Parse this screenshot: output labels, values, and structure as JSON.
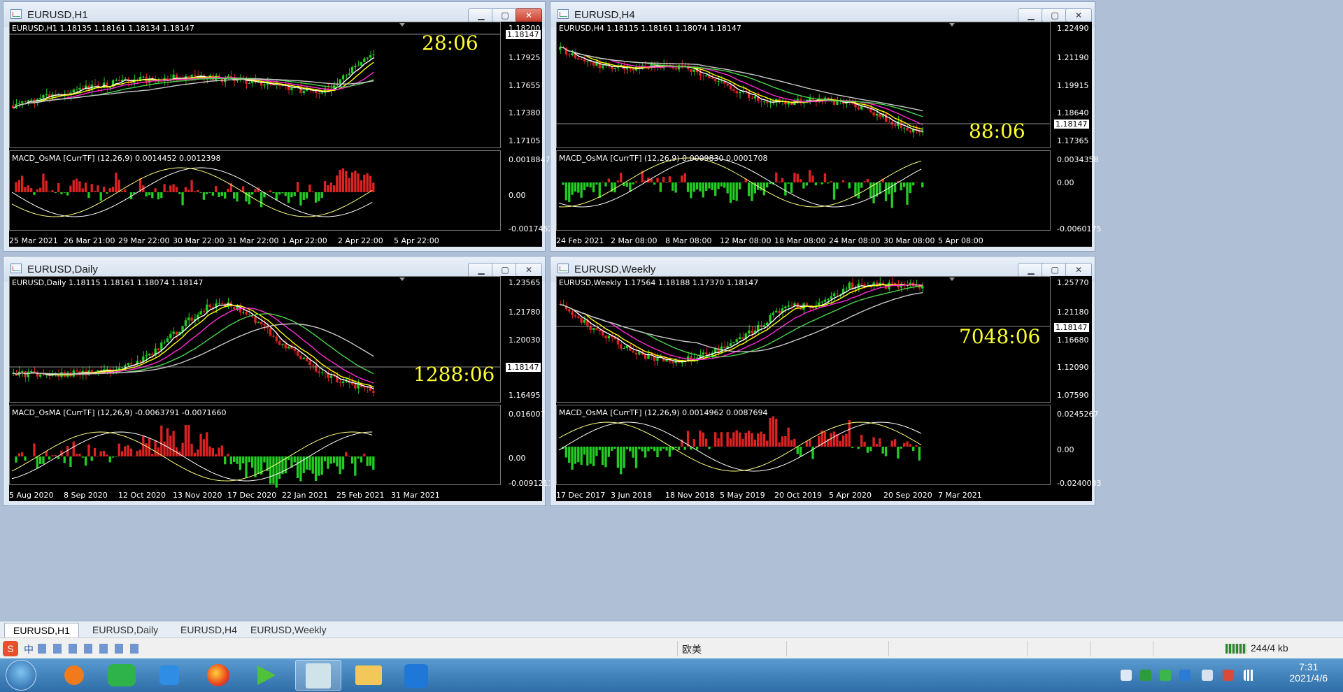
{
  "windows": [
    {
      "id": "h1",
      "title": "EURUSD,H1",
      "info": "EURUSD,H1  1.18135 1.18161 1.18134 1.18147",
      "indicator": "MACD_OsMA [CurrTF] (12,26,9) 0.0014452 0.0012398",
      "price_ticks": [
        "1.18200",
        "1.17925",
        "1.17655",
        "1.17380",
        "1.17105"
      ],
      "current_price": "1.18147",
      "macd_ticks": [
        "0.0018847",
        "0.00",
        "-0.0017452"
      ],
      "countdown": "28:06",
      "dates": [
        "25 Mar 2021",
        "26 Mar 21:00",
        "29 Mar 22:00",
        "30 Mar 22:00",
        "31 Mar 22:00",
        "1 Apr 22:00",
        "2 Apr 22:00",
        "5 Apr 22:00"
      ],
      "close_active": true
    },
    {
      "id": "h4",
      "title": "EURUSD,H4",
      "info": "EURUSD,H4  1.18115 1.18161 1.18074 1.18147",
      "indicator": "MACD_OsMA [CurrTF] (12,26,9) 0.0009830 0.0001708",
      "price_ticks": [
        "1.22490",
        "1.21190",
        "1.19915",
        "1.18640",
        "1.17365"
      ],
      "current_price": "1.18147",
      "macd_ticks": [
        "0.0034358",
        "0.00",
        "-0.0060175"
      ],
      "countdown": "88:06",
      "dates": [
        "24 Feb 2021",
        "2 Mar 08:00",
        "8 Mar 08:00",
        "12 Mar 08:00",
        "18 Mar 08:00",
        "24 Mar 08:00",
        "30 Mar 08:00",
        "5 Apr 08:00"
      ],
      "close_active": false
    },
    {
      "id": "daily",
      "title": "EURUSD,Daily",
      "info": "EURUSD,Daily  1.18115 1.18161 1.18074 1.18147",
      "indicator": "MACD_OsMA [CurrTF] (12,26,9) -0.0063791 -0.0071660",
      "price_ticks": [
        "1.23565",
        "1.21780",
        "1.20030",
        "1.18147",
        "1.16495"
      ],
      "current_price": "1.18147",
      "macd_ticks": [
        "0.016007",
        "0.00",
        "-0.0091211"
      ],
      "countdown": "1288:06",
      "dates": [
        "5 Aug 2020",
        "8 Sep 2020",
        "12 Oct 2020",
        "13 Nov 2020",
        "17 Dec 2020",
        "22 Jan 2021",
        "25 Feb 2021",
        "31 Mar 2021"
      ],
      "close_active": false
    },
    {
      "id": "weekly",
      "title": "EURUSD,Weekly",
      "info": "EURUSD,Weekly  1.17564 1.18188 1.17370 1.18147",
      "indicator": "MACD_OsMA [CurrTF] (12,26,9) 0.0014962 0.0087694",
      "price_ticks": [
        "1.25770",
        "1.21180",
        "1.16680",
        "1.12090",
        "1.07590"
      ],
      "current_price": "1.18147",
      "macd_ticks": [
        "0.0245267",
        "0.00",
        "-0.0240033"
      ],
      "countdown": "7048:06",
      "dates": [
        "17 Dec 2017",
        "3 Jun 2018",
        "18 Nov 2018",
        "5 May 2019",
        "20 Oct 2019",
        "5 Apr 2020",
        "20 Sep 2020",
        "7 Mar 2021"
      ],
      "close_active": false
    }
  ],
  "tabs": [
    "EURUSD,H1",
    "EURUSD,Daily",
    "EURUSD,H4",
    "EURUSD,Weekly"
  ],
  "status": {
    "profile": "欧美",
    "traffic": "244/4 kb"
  },
  "ime": "中",
  "clock": {
    "time": "7:31",
    "date": "2021/4/6"
  },
  "colors": {
    "bull": "#22cc22",
    "bear": "#dd2222",
    "countdown": "#ffff30",
    "ma_white": "#ffffff",
    "ma_yellow": "#ffff00",
    "ma_magenta": "#ff2bd6",
    "ma_green": "#4cd24c",
    "ma_gray": "#c8c8c8"
  }
}
